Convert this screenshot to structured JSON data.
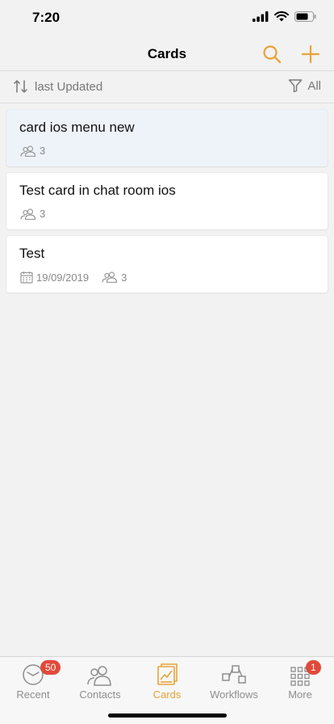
{
  "status": {
    "time": "7:20"
  },
  "nav": {
    "title": "Cards",
    "accent": "#e8a33a"
  },
  "filters": {
    "sort_label": "last Updated",
    "filter_label": "All"
  },
  "cards": [
    {
      "title": "card ios menu new",
      "date": "",
      "members": "3"
    },
    {
      "title": "Test card in chat room ios",
      "date": "",
      "members": "3"
    },
    {
      "title": "Test",
      "date": "19/09/2019",
      "members": "3"
    }
  ],
  "tabs": [
    {
      "label": "Recent",
      "badge": "50",
      "icon": "clock-icon"
    },
    {
      "label": "Contacts",
      "badge": "",
      "icon": "contacts-icon"
    },
    {
      "label": "Cards",
      "badge": "",
      "icon": "cards-icon"
    },
    {
      "label": "Workflows",
      "badge": "",
      "icon": "workflows-icon"
    },
    {
      "label": "More",
      "badge": "1",
      "icon": "grid-icon"
    }
  ]
}
